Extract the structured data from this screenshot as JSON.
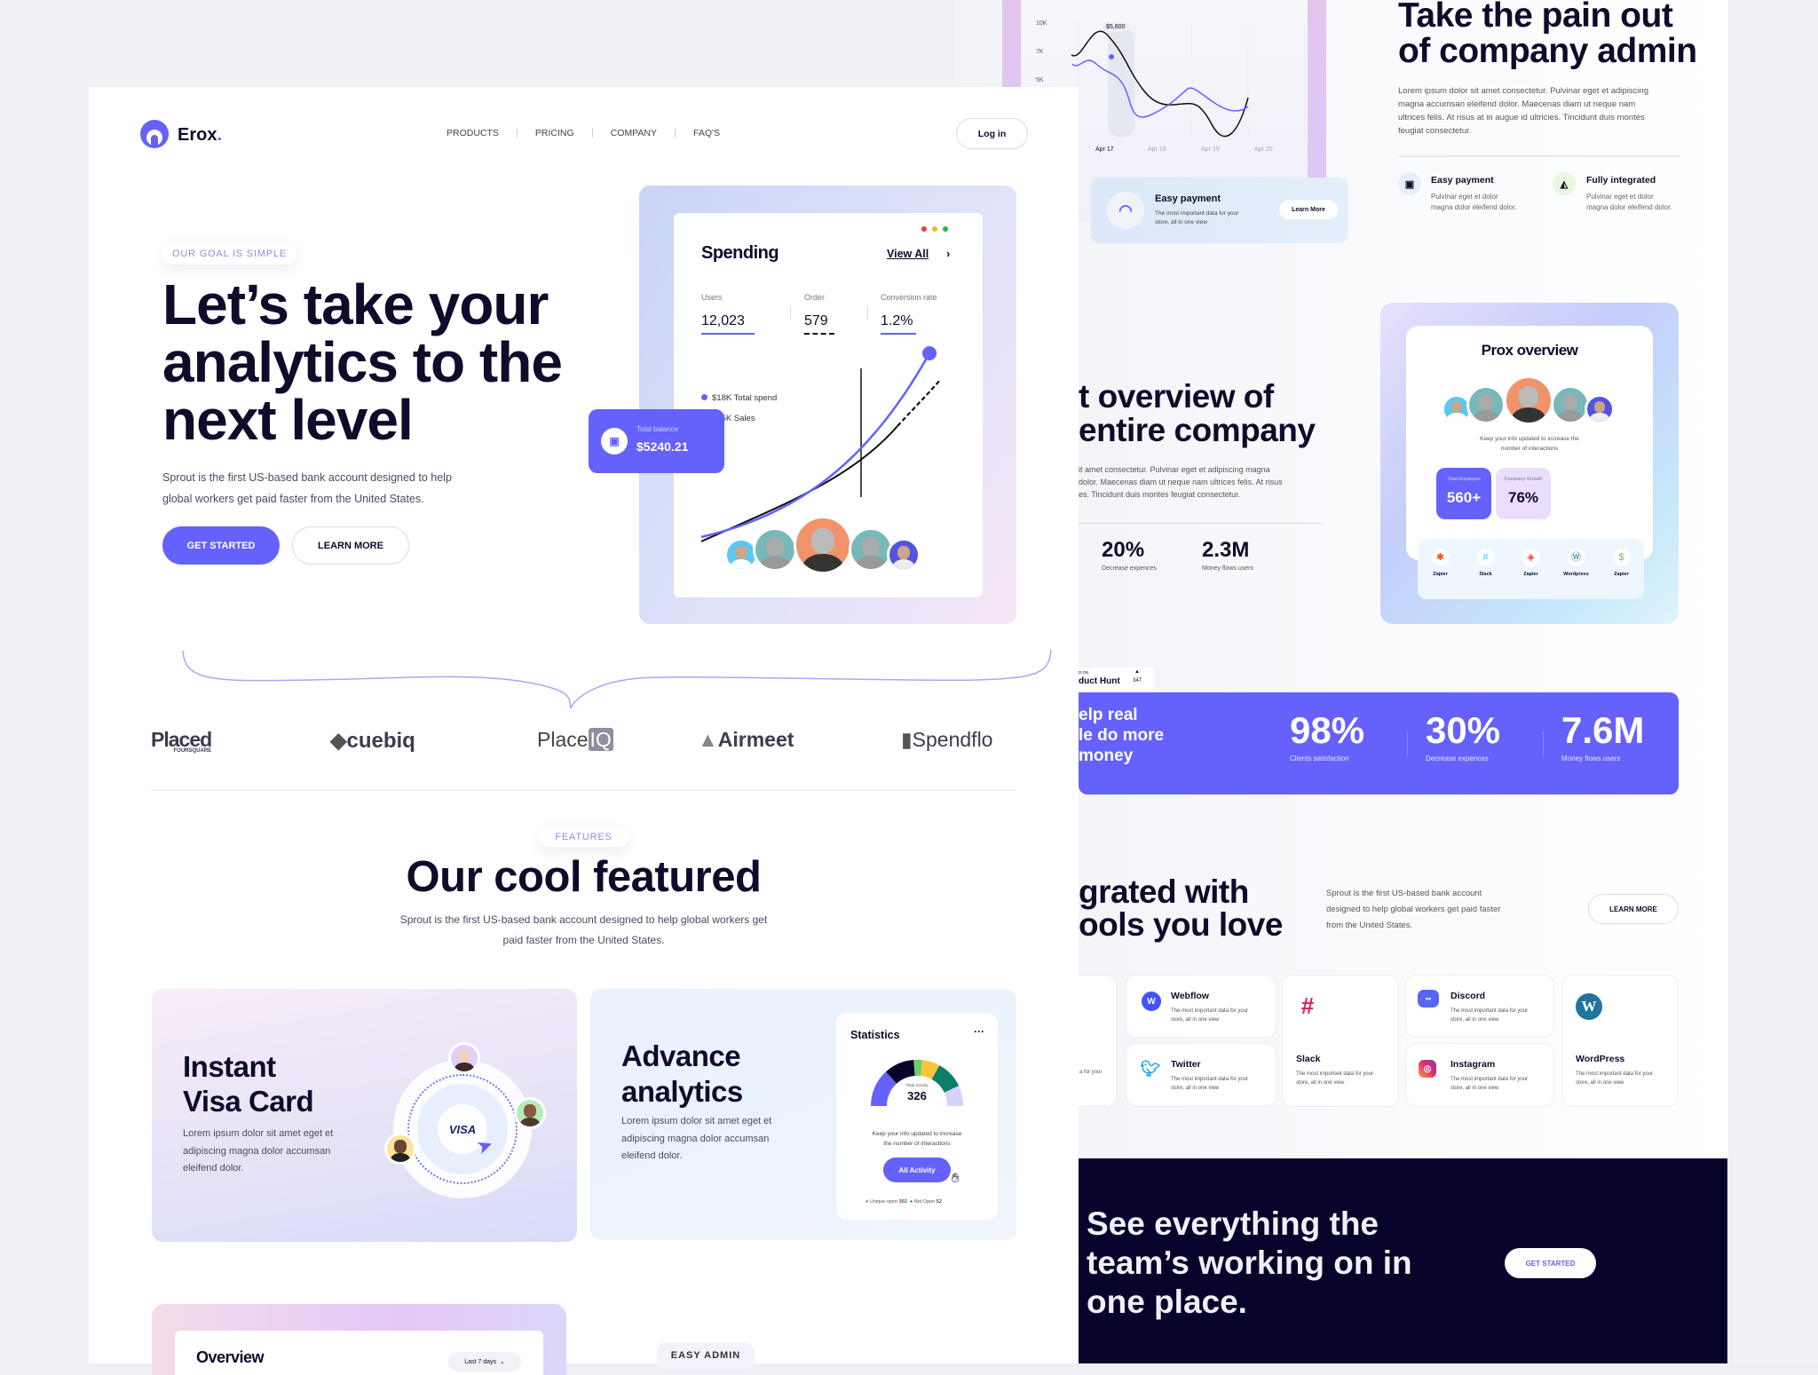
{
  "brand": {
    "name": "Erox",
    "dot": ".",
    "accent": "#6461fc",
    "dark": "#07032a"
  },
  "nav": {
    "items": [
      "PRODUCTS",
      "PRICING",
      "COMPANY",
      "FAQ'S"
    ],
    "login": "Log in"
  },
  "hero": {
    "tag": "OUR GOAL IS SIMPLE",
    "title_lines": [
      "Let’s take your",
      "analytics to the",
      "next level"
    ],
    "text_lines": [
      "Sprout is the first US-based bank account designed to help",
      "global workers get paid faster from the United States."
    ],
    "get_started": "GET STARTED",
    "learn_more": "LEARN MORE"
  },
  "spending": {
    "title": "Spending",
    "view_all": "View All",
    "stats": [
      {
        "label": "Users",
        "value": "12,023"
      },
      {
        "label": "Order",
        "value": "579"
      },
      {
        "label": "Conversion rate",
        "value": "1.2%"
      }
    ],
    "legend": [
      "$18K Total spend",
      "$15K Sales"
    ],
    "balance_label": "Total balance",
    "balance_value": "$5240.21",
    "icon": "wallet-icon"
  },
  "logos": [
    {
      "name": "Placed",
      "sub": "FOURSQUARE"
    },
    {
      "name": "cuebiq"
    },
    {
      "name": "Place",
      "badge": "IQ"
    },
    {
      "name": "Airmeet"
    },
    {
      "name": "Spendflo"
    }
  ],
  "features": {
    "tag": "FEATURES",
    "title": "Our cool featured",
    "text_lines": [
      "Sprout is the first US-based bank account designed to help global workers get",
      "paid faster from the United States."
    ],
    "visa": {
      "title_lines": [
        "Instant",
        "Visa Card"
      ],
      "text_lines": [
        "Lorem ipsum dolor sit amet eget et",
        "adipiscing magna dolor accumsan",
        "eleifend dolor."
      ],
      "card_brand": "VISA"
    },
    "analytics": {
      "title_lines": [
        "Advance",
        "analytics"
      ],
      "text_lines": [
        "Lorem ipsum dolor sit amet eget et",
        "adipiscing magna dolor accumsan",
        "eleifend dolor."
      ]
    },
    "statistics": {
      "title": "Statistics",
      "gauge_label": "Total Activity",
      "gauge_value": "326",
      "text_lines": [
        "Keep your info updated to increase",
        "the number of interactions"
      ],
      "button": "All Activity",
      "legend": [
        {
          "label": "Unique open",
          "value": "302",
          "color": "#6461fc"
        },
        {
          "label": "Not Open",
          "value": "52",
          "color": "#0b7d6b"
        }
      ]
    },
    "overview": {
      "title": "Overview",
      "range": "Last 7 days"
    },
    "easy_admin": "EASY ADMIN"
  },
  "back_chart": {
    "y_ticks": [
      "10K",
      "7K",
      "5K"
    ],
    "x_ticks": [
      "Apr 17",
      "Apr 18",
      "Apr 19",
      "Apr 20"
    ],
    "tooltip": "$5,600"
  },
  "easy_payment_card": {
    "title": "Easy payment",
    "text_lines": [
      "The most important data for your",
      "store, all in one view"
    ],
    "button": "Learn More"
  },
  "admin": {
    "title_lines": [
      "Take the pain out",
      "of company admin"
    ],
    "text_lines": [
      "Lorem ipsum dolor sit amet consectetur. Pulvinar eget et adipiscing",
      "magna accumsan eleifend dolor. Maecenas diam ut neque nam",
      "ultrices felis. At risus at in augue id ultricies. Tincidunt duis montes",
      "feugiat consectetur."
    ],
    "features": [
      {
        "title": "Easy payment",
        "text_lines": [
          "Pulvinar eget et dolor",
          "magna dolor eleifend dolor."
        ]
      },
      {
        "title": "Fully integrated",
        "text_lines": [
          "Pulvinar eget et dolor",
          "magna dolor eleifend dolor."
        ]
      }
    ]
  },
  "company": {
    "title_lines": [
      "t overview of",
      "entire company"
    ],
    "text_lines": [
      "it amet consectetur. Pulvinar eget et adipiscing magna",
      "dolor. Maecenas diam ut neque nam ultrices felis. At risus",
      "es. Tincidunt duis montes feugiat consectetur."
    ],
    "stats": [
      {
        "value": "20%",
        "label": "Decrease expences"
      },
      {
        "value": "2.3M",
        "label": "Money flows users"
      }
    ]
  },
  "prox": {
    "title": "Prox overview",
    "text_lines": [
      "Keep your info updated to increase the",
      "number of interactions"
    ],
    "employee_label": "Total Employee",
    "employee_value": "560+",
    "growth_label": "Company Growth",
    "growth_value": "76%",
    "apps": [
      {
        "name": "Zapier",
        "color": "#ff4a00"
      },
      {
        "name": "Slack",
        "color": "#36c5f0"
      },
      {
        "name": "Zapier",
        "color": "#ea4335"
      },
      {
        "name": "Wordpress",
        "color": "#21759b"
      },
      {
        "name": "Zapier",
        "color": "#7ab55c"
      }
    ]
  },
  "product_hunt": {
    "small": "D ON",
    "name": "duct Hunt",
    "votes": "347"
  },
  "banner": {
    "text_lines": [
      "elp real",
      "le do more",
      "money"
    ],
    "stats": [
      {
        "value": "98%",
        "label": "Clients satisfaction"
      },
      {
        "value": "30%",
        "label": "Decrease expences"
      },
      {
        "value": "7.6M",
        "label": "Money flows users"
      }
    ]
  },
  "integrations": {
    "title_lines": [
      "grated with",
      "ools you love"
    ],
    "text_lines": [
      "Sprout is the first US-based bank account",
      "designed to help global workers get paid faster",
      "from the United States."
    ],
    "learn_more": "LEARN MORE",
    "partial_text": "a for your",
    "cards": [
      {
        "name": "Webflow",
        "text_lines": [
          "The most important data for your",
          "store, all in one view"
        ]
      },
      {
        "name": "Twitter",
        "text_lines": [
          "The most important data for your",
          "store, all in one view"
        ]
      },
      {
        "name": "Slack",
        "text_lines": [
          "The most important data for your",
          "store, all in one view"
        ]
      },
      {
        "name": "Discord",
        "text_lines": [
          "The most important data for your",
          "store, all in one view"
        ]
      },
      {
        "name": "Instagram",
        "text_lines": [
          "The most important data for your",
          "store, all in one view"
        ]
      },
      {
        "name": "WordPress",
        "text_lines": [
          "The most important data for your",
          "store, all in one view"
        ]
      }
    ]
  },
  "cta": {
    "title_lines": [
      "See everything the",
      "team’s working on in",
      "one place."
    ],
    "button": "GET STARTED"
  }
}
